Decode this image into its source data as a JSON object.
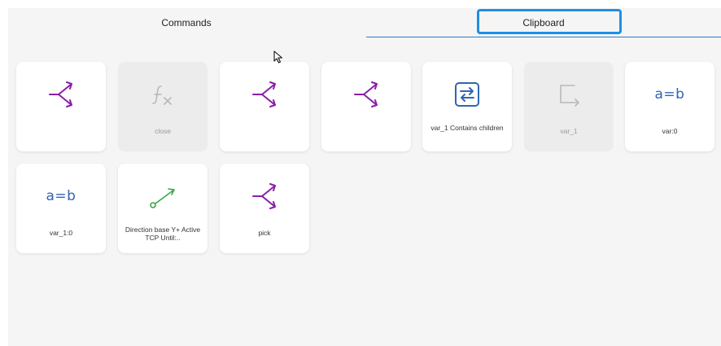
{
  "tabs": {
    "commands": "Commands",
    "clipboard": "Clipboard"
  },
  "tiles": [
    {
      "icon": "branch-icon",
      "caption": ""
    },
    {
      "icon": "function-icon",
      "caption": "close",
      "disabled": true
    },
    {
      "icon": "branch-icon",
      "caption": ""
    },
    {
      "icon": "branch-icon",
      "caption": ""
    },
    {
      "icon": "swap-icon",
      "caption": "var_1 Contains children"
    },
    {
      "icon": "exit-arrow-icon",
      "caption": "var_1",
      "disabled": true
    },
    {
      "icon": "assign-icon",
      "caption": "var:0"
    },
    {
      "icon": "assign-icon",
      "caption": "var_1:0"
    },
    {
      "icon": "direction-icon",
      "caption": "Direction base Y+ Active TCP Until:.."
    },
    {
      "icon": "branch-icon",
      "caption": "pick"
    }
  ],
  "icon_text": {
    "assign": "a=b"
  },
  "colors": {
    "branch": "#8a1fa8",
    "swap": "#2f66b3",
    "assign": "#2f66b3",
    "direction": "#3aa54a",
    "disabled_icon": "#b8b8b8",
    "tab_underline": "#2f78c4",
    "focus_ring": "#1e8fe6"
  }
}
